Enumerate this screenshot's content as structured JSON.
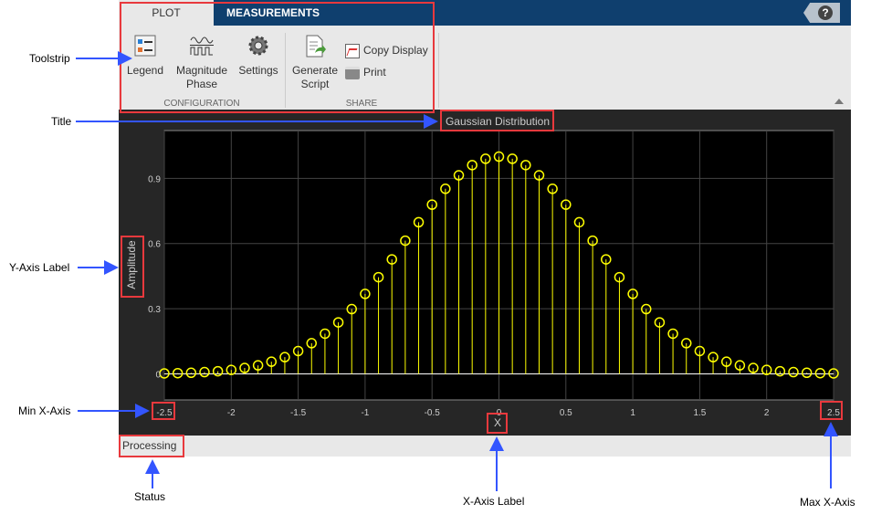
{
  "tabs": [
    {
      "label": "PLOT"
    },
    {
      "label": "MEASUREMENTS"
    }
  ],
  "help_icon": "question-icon",
  "toolstrip": {
    "configuration": {
      "label": "CONFIGURATION",
      "buttons": [
        {
          "label": "Legend",
          "icon": "legend-icon"
        },
        {
          "label": "Magnitude Phase",
          "line1": "Magnitude",
          "line2": "Phase",
          "icon": "magnitude-phase-icon"
        },
        {
          "label": "Settings",
          "icon": "gear-icon"
        }
      ]
    },
    "share": {
      "label": "SHARE",
      "generate": {
        "line1": "Generate",
        "line2": "Script"
      },
      "copy": "Copy Display",
      "print": "Print"
    }
  },
  "status": "Processing",
  "annotations": {
    "toolstrip": "Toolstrip",
    "title": "Title",
    "ylabel": "Y-Axis Label",
    "minx": "Min X-Axis",
    "status": "Status",
    "xlabel": "X-Axis Label",
    "maxx": "Max X-Axis"
  },
  "colors": {
    "accent": "#0f3f6e",
    "stem": "#ffff00",
    "annotation_box": "#e8393d",
    "arrow": "#3355ff"
  },
  "chart_data": {
    "type": "stem",
    "title": "Gaussian Distribution",
    "xlabel": "X",
    "ylabel": "Amplitude",
    "xlim": [
      -2.5,
      2.5
    ],
    "ylim": [
      -0.12,
      1.12
    ],
    "xticks": [
      "-2.5",
      "-2",
      "-1.5",
      "-1",
      "-0.5",
      "0",
      "0.5",
      "1",
      "1.5",
      "2",
      "2.5"
    ],
    "xtick_values": [
      -2.5,
      -2,
      -1.5,
      -1,
      -0.5,
      0,
      0.5,
      1,
      1.5,
      2,
      2.5
    ],
    "yticks": [
      "0",
      "0.3",
      "0.6",
      "0.9"
    ],
    "ytick_values": [
      0,
      0.3,
      0.6,
      0.9
    ],
    "grid": true,
    "x_start": -2.5,
    "x_step": 0.1,
    "values": [
      0.002,
      0.003,
      0.005,
      0.008,
      0.012,
      0.018,
      0.027,
      0.039,
      0.056,
      0.077,
      0.105,
      0.141,
      0.185,
      0.237,
      0.298,
      0.368,
      0.445,
      0.527,
      0.613,
      0.698,
      0.779,
      0.852,
      0.914,
      0.961,
      0.99,
      1.0,
      0.99,
      0.961,
      0.914,
      0.852,
      0.779,
      0.698,
      0.613,
      0.527,
      0.445,
      0.368,
      0.298,
      0.237,
      0.185,
      0.141,
      0.105,
      0.077,
      0.056,
      0.039,
      0.027,
      0.018,
      0.012,
      0.008,
      0.005,
      0.003,
      0.002
    ]
  }
}
